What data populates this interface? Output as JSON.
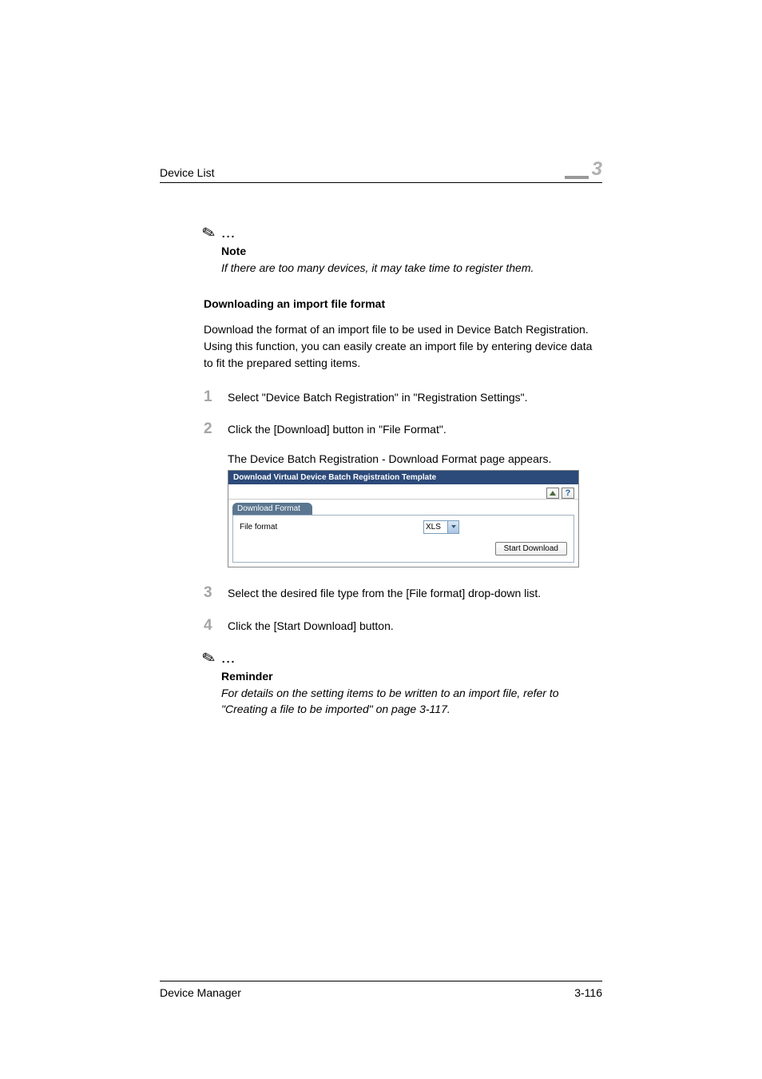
{
  "header": {
    "section": "Device List",
    "chapter": "3"
  },
  "note1": {
    "dots": "...",
    "label": "Note",
    "text": "If there are too many devices, it may take time to register them."
  },
  "section_heading": "Downloading an import file format",
  "intro": "Download the format of an import file to be used in Device Batch Registration. Using this function, you can easily create an import file by entering device data to fit the prepared setting items.",
  "steps": {
    "s1": {
      "num": "1",
      "text": "Select \"Device Batch Registration\" in \"Registration Settings\"."
    },
    "s2": {
      "num": "2",
      "text": "Click the [Download] button in \"File Format\".",
      "follow": "The Device Batch Registration - Download Format page appears."
    },
    "s3": {
      "num": "3",
      "text": "Select the desired file type from the [File format] drop-down list."
    },
    "s4": {
      "num": "4",
      "text": "Click the [Start Download] button."
    }
  },
  "screenshot": {
    "title": "Download Virtual Device Batch Registration Template",
    "subheader": "Download Format",
    "file_format_label": "File format",
    "file_format_value": "XLS",
    "download_button": "Start Download",
    "help_icon": "?"
  },
  "reminder": {
    "dots": "...",
    "label": "Reminder",
    "text": "For details on the setting items to be written to an import file, refer to \"Creating a file to be imported\" on page 3-117."
  },
  "footer": {
    "left": "Device Manager",
    "right": "3-116"
  }
}
